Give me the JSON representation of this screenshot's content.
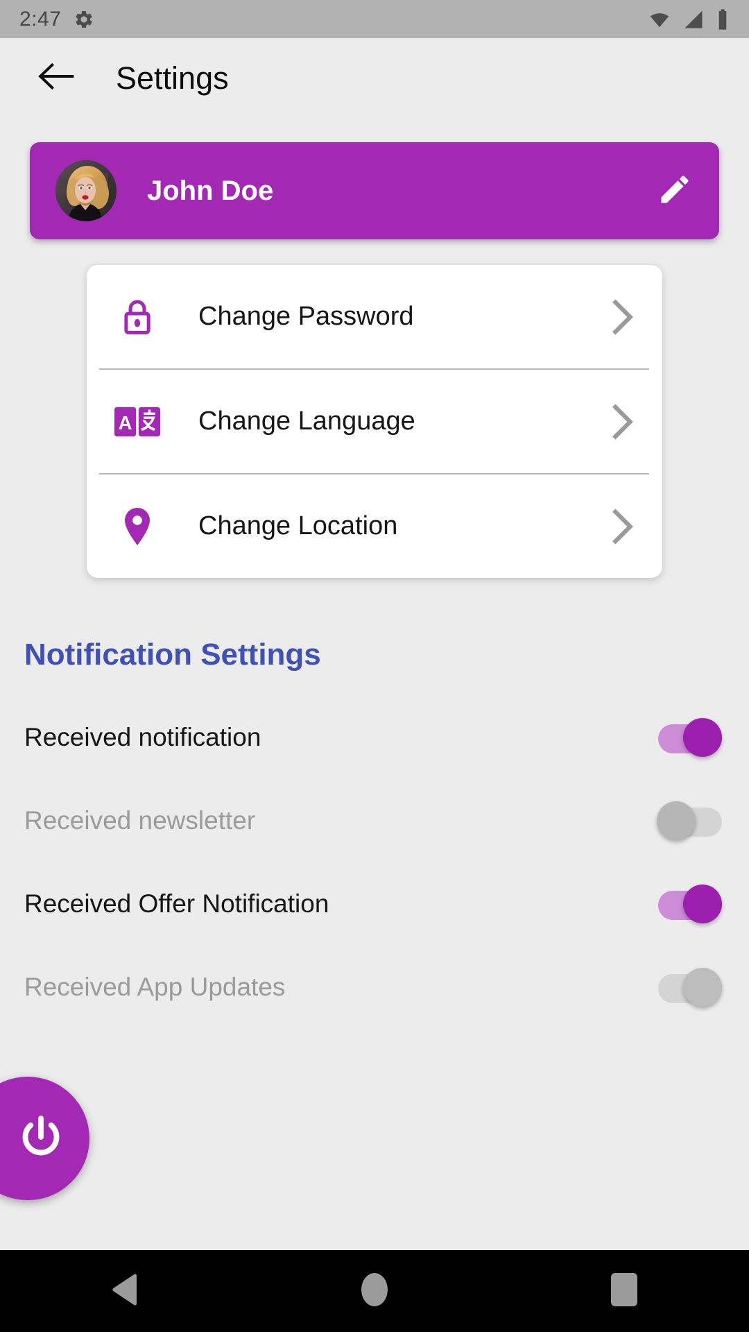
{
  "statusbar": {
    "time": "2:47",
    "icons": [
      "gear-icon",
      "wifi-icon",
      "cellular-signal-icon",
      "battery-icon"
    ],
    "background_color": "#b2b2b2"
  },
  "appbar": {
    "back_icon": "arrow-left-icon",
    "title": "Settings",
    "background_color": "#ececec"
  },
  "profile": {
    "name": "John Doe",
    "avatar_alt": "user-profile-photo",
    "edit_icon": "pencil-icon",
    "background_color": "#a328b3"
  },
  "settings_list": [
    {
      "icon": "lock-icon",
      "label": "Change Password",
      "chevron": "chevron-right-icon"
    },
    {
      "icon": "translate-icon",
      "label": "Change Language",
      "chevron": "chevron-right-icon"
    },
    {
      "icon": "location-pin-icon",
      "label": "Change Location",
      "chevron": "chevron-right-icon"
    }
  ],
  "notifications": {
    "heading": "Notification Settings",
    "heading_color": "#3f51b5",
    "rows": [
      {
        "label": "Received notification",
        "state": "on",
        "enabled": true
      },
      {
        "label": "Received newsletter",
        "state": "off",
        "enabled": false
      },
      {
        "label": "Received Offer Notification",
        "state": "on",
        "enabled": true
      },
      {
        "label": "Received App Updates",
        "state": "off-right",
        "enabled": false
      }
    ],
    "on_track_color": "#cc8cd6",
    "on_thumb_color": "#9c1fb0",
    "off_track_color": "#d4d4d4",
    "off_thumb_color": "#b6b6b6"
  },
  "fab": {
    "icon": "power-icon",
    "color": "#a328b3"
  },
  "navbar": {
    "buttons": [
      {
        "icon": "back-triangle-icon"
      },
      {
        "icon": "home-circle-icon"
      },
      {
        "icon": "recents-square-icon"
      }
    ],
    "background_color": "#000000"
  }
}
